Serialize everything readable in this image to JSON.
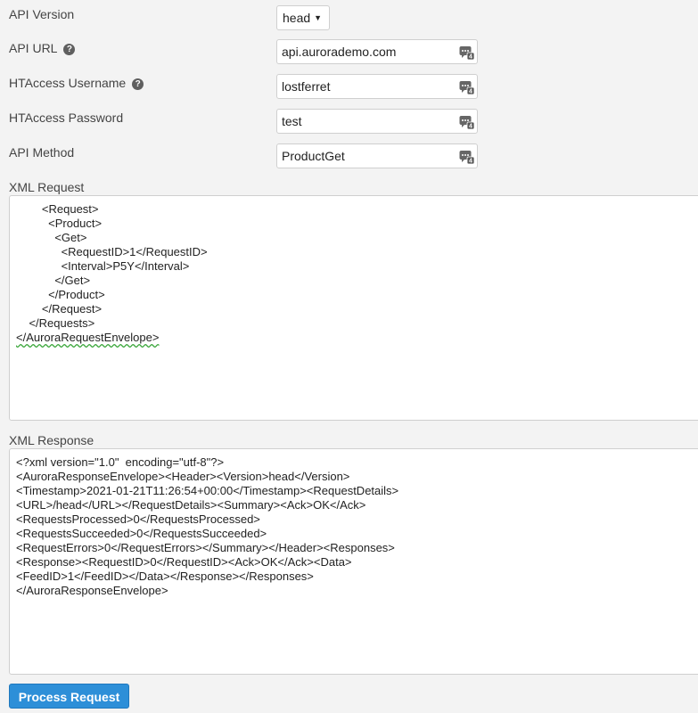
{
  "form": {
    "api_version": {
      "label": "API Version",
      "value": "head"
    },
    "api_url": {
      "label": "API URL",
      "value": "api.aurorademo.com",
      "help": "?"
    },
    "htaccess_username": {
      "label": "HTAccess Username",
      "value": "lostferret",
      "help": "?"
    },
    "htaccess_password": {
      "label": "HTAccess Password",
      "value": "test"
    },
    "api_method": {
      "label": "API Method",
      "value": "ProductGet"
    }
  },
  "xml_request": {
    "label": "XML Request",
    "text": "        <Request>\n          <Product>\n            <Get>\n              <RequestID>1</RequestID>\n              <Interval>P5Y</Interval>\n            </Get>\n          </Product>\n        </Request>\n    </Requests>\n",
    "last_line": "</AuroraRequestEnvelope>"
  },
  "xml_response": {
    "label": "XML Response",
    "text": "<?xml version=\"1.0\"  encoding=\"utf-8\"?>\n<AuroraResponseEnvelope><Header><Version>head</Version>\n<Timestamp>2021-01-21T11:26:54+00:00</Timestamp><RequestDetails>\n<URL>/head</URL></RequestDetails><Summary><Ack>OK</Ack>\n<RequestsProcessed>0</RequestsProcessed>\n<RequestsSucceeded>0</RequestsSucceeded>\n<RequestErrors>0</RequestErrors></Summary></Header><Responses>\n<Response><RequestID>0</RequestID><Ack>OK</Ack><Data>\n<FeedID>1</FeedID></Data></Response></Responses>\n</AuroraResponseEnvelope>"
  },
  "buttons": {
    "process_request": "Process Request"
  },
  "icons": {
    "token_badge": "4"
  }
}
